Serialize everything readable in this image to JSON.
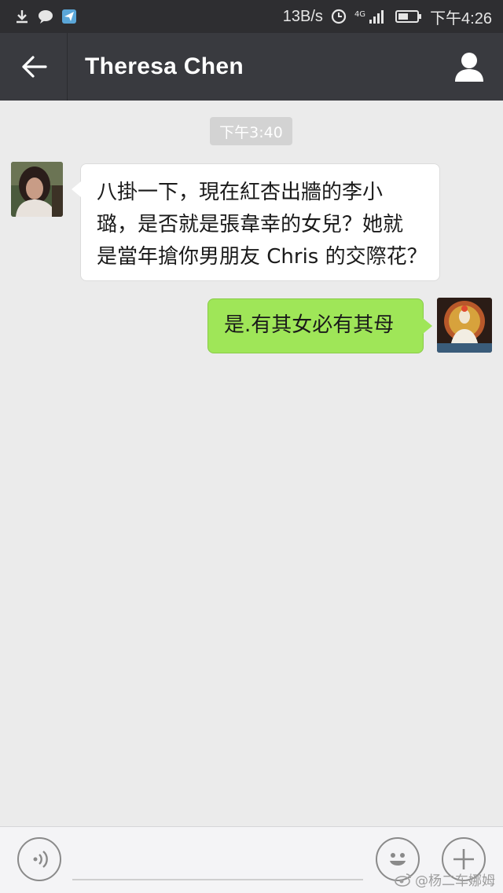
{
  "status_bar": {
    "speed": "13B/s",
    "network": "4G",
    "time": "下午4:26",
    "left_icons": [
      "download-icon",
      "chat-bubble-icon",
      "send-app-icon"
    ],
    "right_icons": [
      "data-saver-icon",
      "signal-icon",
      "battery-icon"
    ]
  },
  "header": {
    "title": "Theresa Chen",
    "back_icon": "back-arrow-icon",
    "profile_icon": "person-icon",
    "bg_color": "#393a3f"
  },
  "chat": {
    "timestamp": "下午3:40",
    "messages": [
      {
        "from": "contact",
        "lines": [
          "八掛一下，現在紅杏出牆的李小",
          "璐，是否就是張韋幸的女兒？她就",
          "是當年搶你男朋友 Chris 的交際花？"
        ]
      },
      {
        "from": "me",
        "lines": [
          "是.有其女必有其母"
        ]
      }
    ],
    "incoming_color": "#ffffff",
    "outgoing_color": "#9fe658"
  },
  "input_bar": {
    "icons": [
      "voice-icon",
      "emoji-icon",
      "plus-icon"
    ],
    "value": ""
  },
  "watermark": {
    "text": "@杨二车娜姆",
    "icon": "weibo-icon"
  }
}
